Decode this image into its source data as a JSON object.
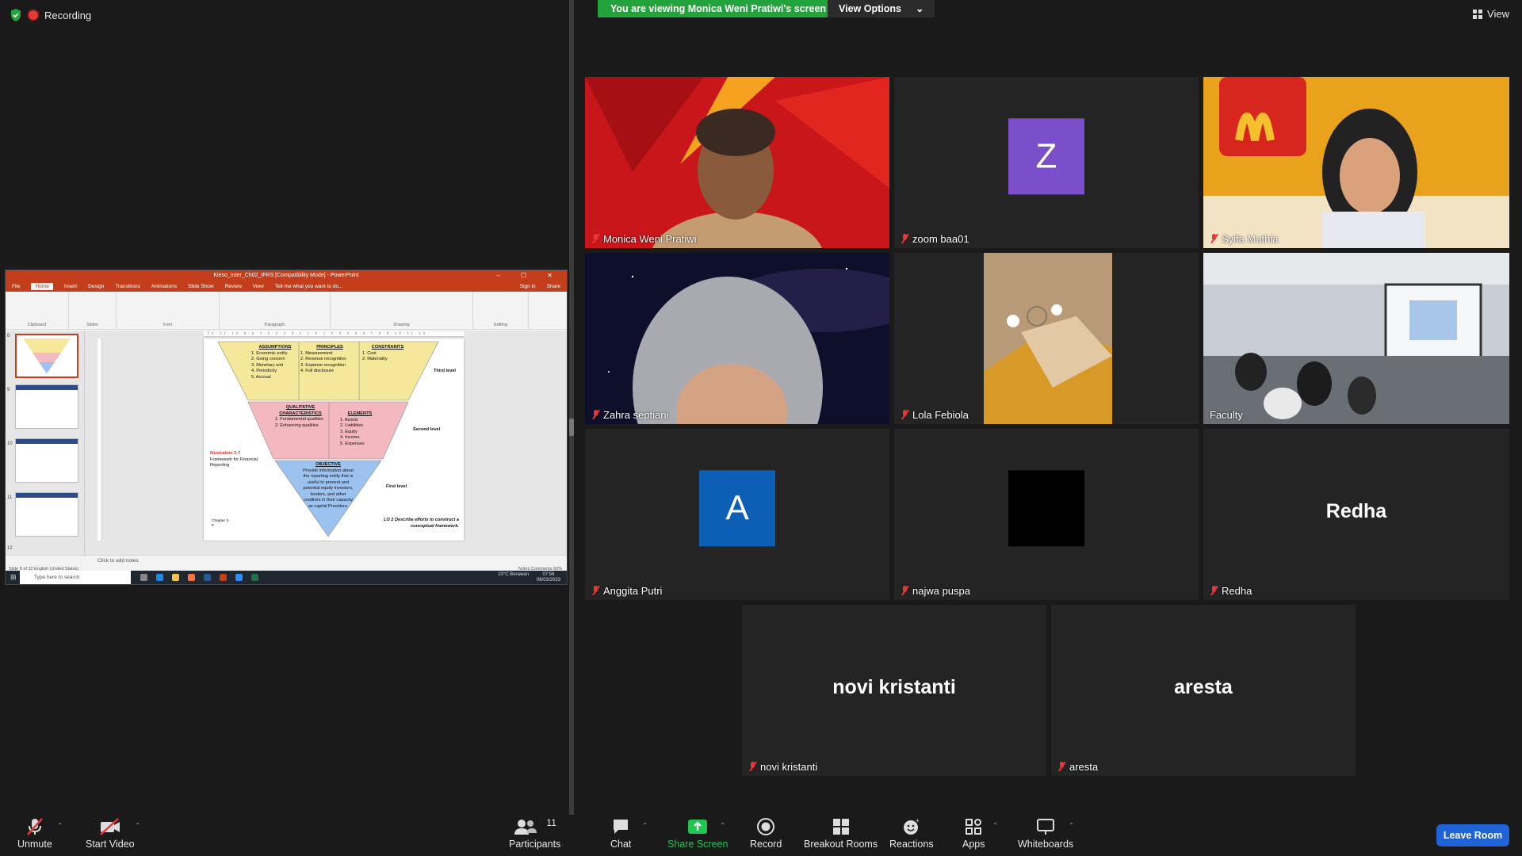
{
  "recording": {
    "label": "Recording"
  },
  "banner": {
    "viewing": "You are viewing Monica Weni Pratiwi's screen",
    "view_options": "View Options",
    "view": "View"
  },
  "ppt": {
    "title": "Kieso_Inter_Ch02_IFRS [Compatibility Mode] - PowerPoint",
    "tabs": [
      "File",
      "Home",
      "Insert",
      "Design",
      "Transitions",
      "Animations",
      "Slide Show",
      "Review",
      "View",
      "Tell me what you want to do...",
      "Sign in",
      "Share"
    ],
    "ribbon_groups": [
      "Clipboard",
      "Slides",
      "Font",
      "Paragraph",
      "Drawing",
      "Editing"
    ],
    "thumb_numbers": [
      "8",
      "9",
      "10",
      "11",
      "12"
    ],
    "notes_placeholder": "Click to add notes",
    "status_left": "Slide 8 of 32     English (United States)",
    "status_right": "Notes   Comments   66%",
    "taskbar_search": "Type here to search",
    "weather": "23°C  Berawan",
    "clock_time": "07:56",
    "clock_date": "06/03/2023",
    "slide": {
      "assumptions_h": "ASSUMPTIONS",
      "assumptions": [
        "1. Economic entity",
        "2. Going concern",
        "3. Monetary unit",
        "4. Periodicity",
        "5. Accrual"
      ],
      "principles_h": "PRINCIPLES",
      "principles": [
        "1. Measurement",
        "2. Revenue recognition",
        "3. Expense recognition",
        "4. Full disclosure"
      ],
      "constraints_h": "CONSTRAINTS",
      "constraints": [
        "1. Cost",
        "2. Materiality"
      ],
      "third_level": "Third level",
      "qualitative_h": "QUALITATIVE CHARACTERISTICS",
      "qualitative": [
        "1. Fundamental qualities",
        "2. Enhancing qualities"
      ],
      "elements_h": "ELEMENTS",
      "elements": [
        "1. Assets",
        "2. Liabilities",
        "3. Equity",
        "4. Income",
        "5. Expenses"
      ],
      "second_level": "Second level",
      "illustration_h": "Illustration 2-7",
      "illustration": "Framework for Financial Reporting",
      "objective_h": "OBJECTIVE",
      "objective": "Provide information about the reporting entity that is useful to present and potential equity investors, lenders, and other creditors in their capacity as capital Providers.",
      "first_level": "First level",
      "chapter": "Chapter 2-8",
      "lo": "LO 2  Describe efforts to construct a conceptual framework."
    }
  },
  "participants": [
    {
      "name": "Monica Weni Pratiwi"
    },
    {
      "name": "zoom baa01",
      "initial": "Z",
      "color": "#7b4fc9"
    },
    {
      "name": "Syifa Muthia"
    },
    {
      "name": "Zahra septiani"
    },
    {
      "name": "Lola Febiola"
    },
    {
      "name": "Faculty"
    },
    {
      "name": "Anggita Putri",
      "initial": "A",
      "color": "#0d5fb5"
    },
    {
      "name": "najwa puspa"
    },
    {
      "name": "Redha",
      "big": "Redha"
    },
    {
      "name": "novi kristanti",
      "big": "novi kristanti"
    },
    {
      "name": "aresta",
      "big": "aresta"
    }
  ],
  "toolbar": {
    "unmute": "Unmute",
    "start_video": "Start Video",
    "participants": "Participants",
    "participants_count": "11",
    "chat": "Chat",
    "share_screen": "Share Screen",
    "record": "Record",
    "breakout": "Breakout Rooms",
    "reactions": "Reactions",
    "apps": "Apps",
    "whiteboards": "Whiteboards",
    "leave": "Leave Room"
  }
}
